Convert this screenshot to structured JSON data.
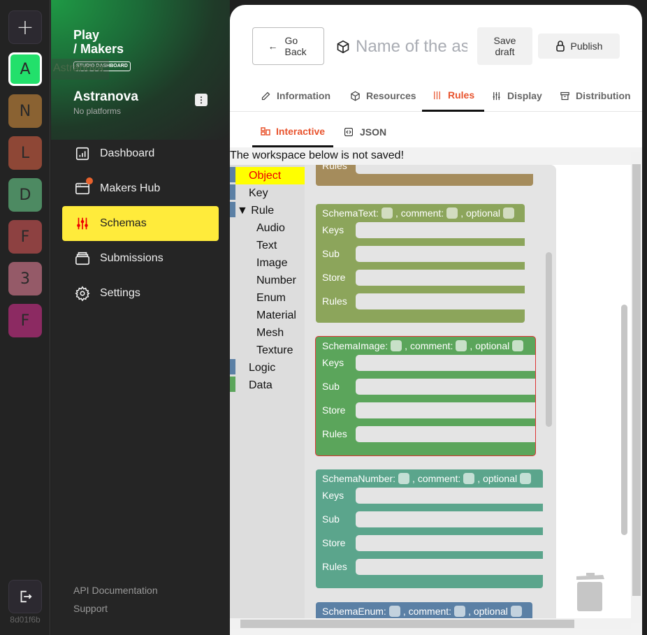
{
  "rail": {
    "add": "+",
    "projects": [
      {
        "letter": "A",
        "color": "#22e06b",
        "active": true
      },
      {
        "letter": "N",
        "color": "#8a6232"
      },
      {
        "letter": "L",
        "color": "#8e4736"
      },
      {
        "letter": "D",
        "color": "#4d8a62"
      },
      {
        "letter": "F",
        "color": "#8d4141"
      },
      {
        "letter": "3",
        "color": "#955a68"
      },
      {
        "letter": "F",
        "color": "#8c2a62"
      }
    ],
    "tooltip": "Astranova",
    "hash": "8d01f6b"
  },
  "sidebar": {
    "logo": [
      "Play",
      "/ Makers"
    ],
    "logo_badge": "STUDIO DASHBOARD",
    "org": "Astranova",
    "org_sub": "No platforms",
    "menu_icon": "kebab-icon",
    "items": [
      {
        "label": "Dashboard",
        "icon": "chart-icon"
      },
      {
        "label": "Makers Hub",
        "icon": "browser-icon",
        "badge": true
      },
      {
        "label": "Schemas",
        "icon": "sliders-icon",
        "active": true
      },
      {
        "label": "Submissions",
        "icon": "stack-icon"
      },
      {
        "label": "Settings",
        "icon": "gear-icon"
      }
    ],
    "footer": [
      "API Documentation",
      "Support"
    ]
  },
  "header": {
    "go_back": "Go Back",
    "name_placeholder": "Name of the asset",
    "save_draft": "Save draft",
    "publish": "Publish"
  },
  "tabs": [
    {
      "label": "Information"
    },
    {
      "label": "Resources"
    },
    {
      "label": "Rules",
      "active": true
    },
    {
      "label": "Display"
    },
    {
      "label": "Distribution"
    }
  ],
  "subtabs": [
    {
      "label": "Interactive",
      "active": true
    },
    {
      "label": "JSON"
    }
  ],
  "workspace": {
    "message": "The workspace below is not saved!",
    "toolbox": [
      {
        "label": "Object",
        "color": "#5b80a5",
        "selected": true
      },
      {
        "label": "Key",
        "color": "#5b80a5"
      },
      {
        "label": "▼ Rule",
        "color": "#5b80a5"
      },
      {
        "label": "Audio",
        "child": true
      },
      {
        "label": "Text",
        "child": true
      },
      {
        "label": "Image",
        "child": true
      },
      {
        "label": "Number",
        "child": true
      },
      {
        "label": "Enum",
        "child": true
      },
      {
        "label": "Material",
        "child": true
      },
      {
        "label": "Mesh",
        "child": true
      },
      {
        "label": "Texture",
        "child": true
      },
      {
        "label": "Logic",
        "color": "#5b80a5"
      },
      {
        "label": "Data",
        "color": "#5ba55b"
      }
    ],
    "blocks": [
      {
        "title": "SchemaText:",
        "color": "#8ca55b",
        "field": "#d2dcc0",
        "rows": [
          "Keys",
          "Sub",
          "Store",
          "Rules"
        ]
      },
      {
        "title": "SchemaImage:",
        "color": "#5ba55b",
        "field": "#c8e0c8",
        "rows": [
          "Keys",
          "Sub",
          "Store",
          "Rules"
        ],
        "selected": true
      },
      {
        "title": "SchemaNumber:",
        "color": "#5ba58c",
        "field": "#c4dfd5",
        "rows": [
          "Keys",
          "Sub",
          "Store",
          "Rules"
        ]
      },
      {
        "title": "SchemaEnum:",
        "color": "#5b80a5",
        "field": "#c3d2de",
        "rows": []
      }
    ],
    "partial_block": {
      "color": "#a58c5c",
      "row": "Rules"
    },
    "comment_label": ", comment:",
    "optional_label": ", optional"
  }
}
